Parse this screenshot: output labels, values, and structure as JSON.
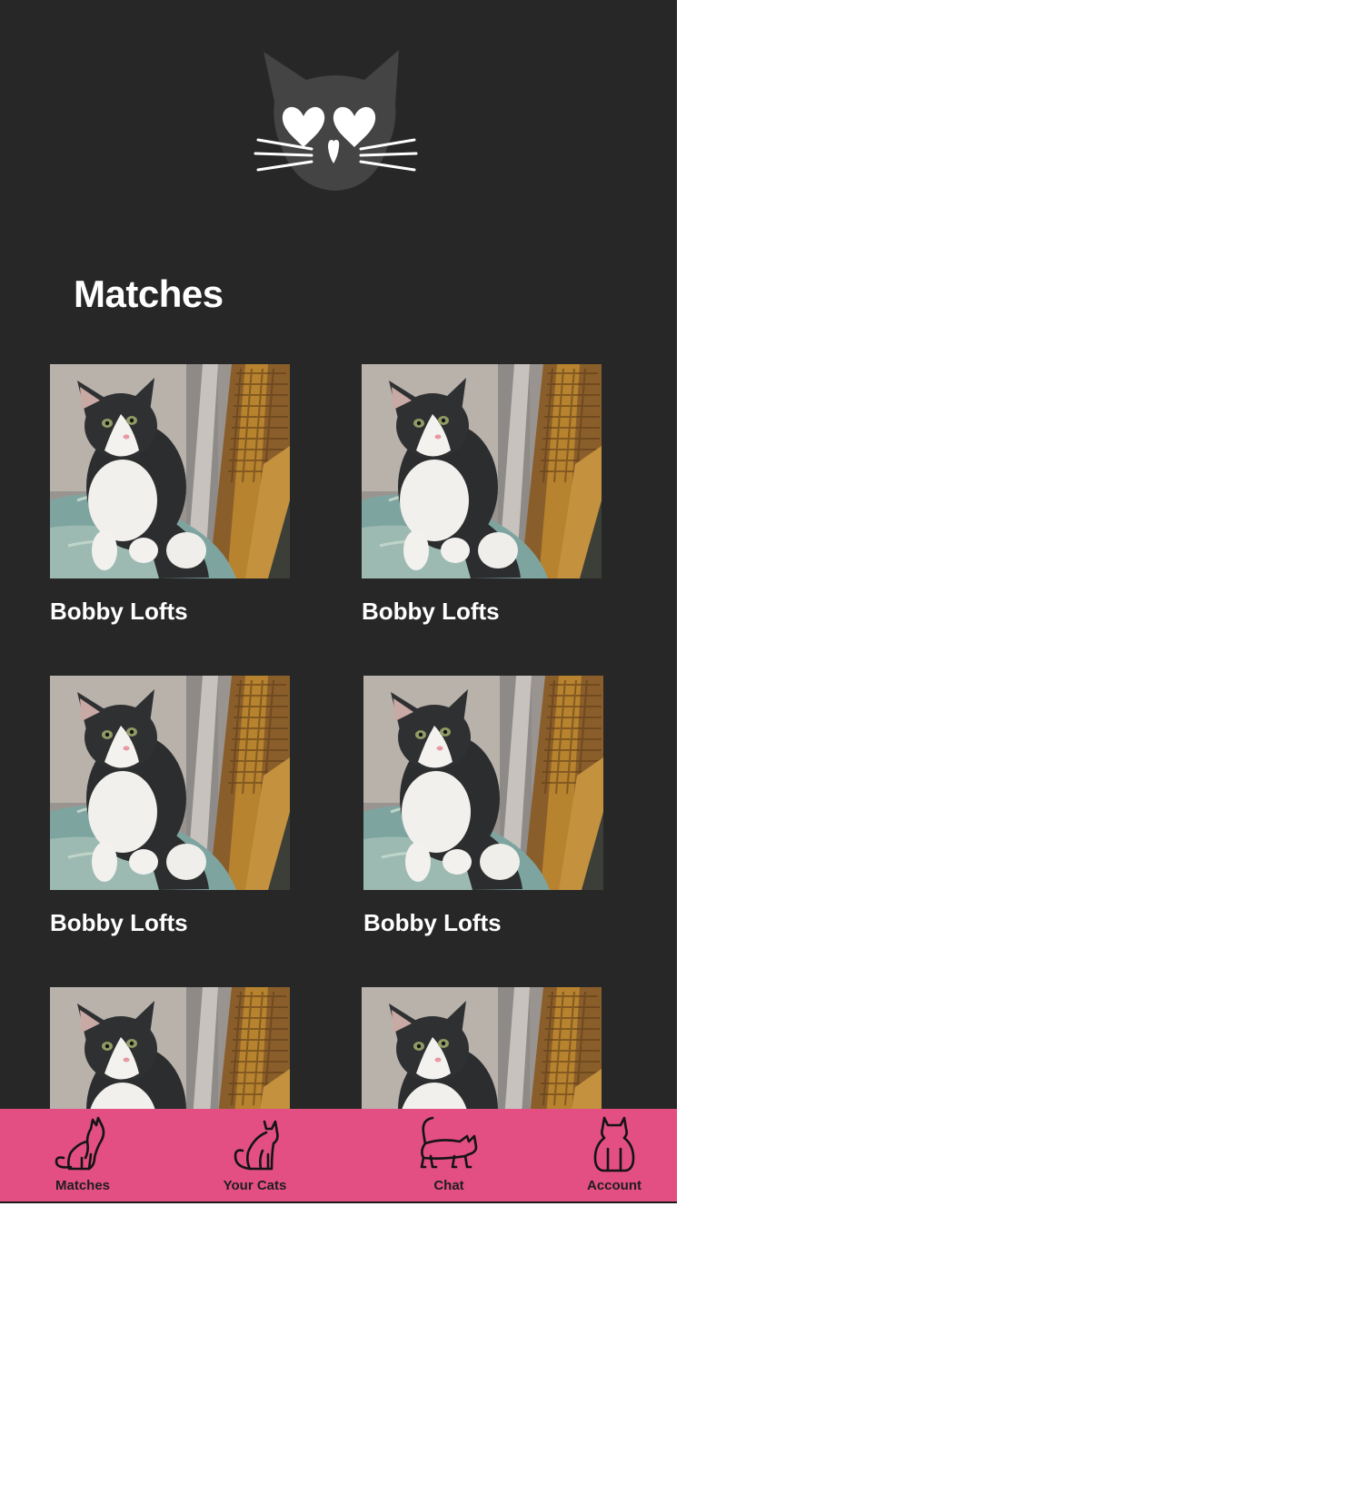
{
  "app": {
    "logo_icon": "cat-heart-eyes-logo",
    "background_color": "#272727",
    "accent_color": "#e34f82"
  },
  "header": {
    "title": "Matches"
  },
  "matches": [
    {
      "name": "Bobby Lofts",
      "photo": "cat-photo"
    },
    {
      "name": "Bobby Lofts",
      "photo": "cat-photo"
    },
    {
      "name": "Bobby Lofts",
      "photo": "cat-photo"
    },
    {
      "name": "Bobby Lofts",
      "photo": "cat-photo"
    },
    {
      "name": "",
      "photo": "cat-photo"
    },
    {
      "name": "",
      "photo": "cat-photo"
    }
  ],
  "nav": {
    "items": [
      {
        "label": "Matches",
        "icon": "cat-sitting-icon"
      },
      {
        "label": "Your Cats",
        "icon": "cat-icon"
      },
      {
        "label": "Chat",
        "icon": "cat-walking-icon"
      },
      {
        "label": "Account",
        "icon": "cat-front-icon"
      }
    ]
  }
}
